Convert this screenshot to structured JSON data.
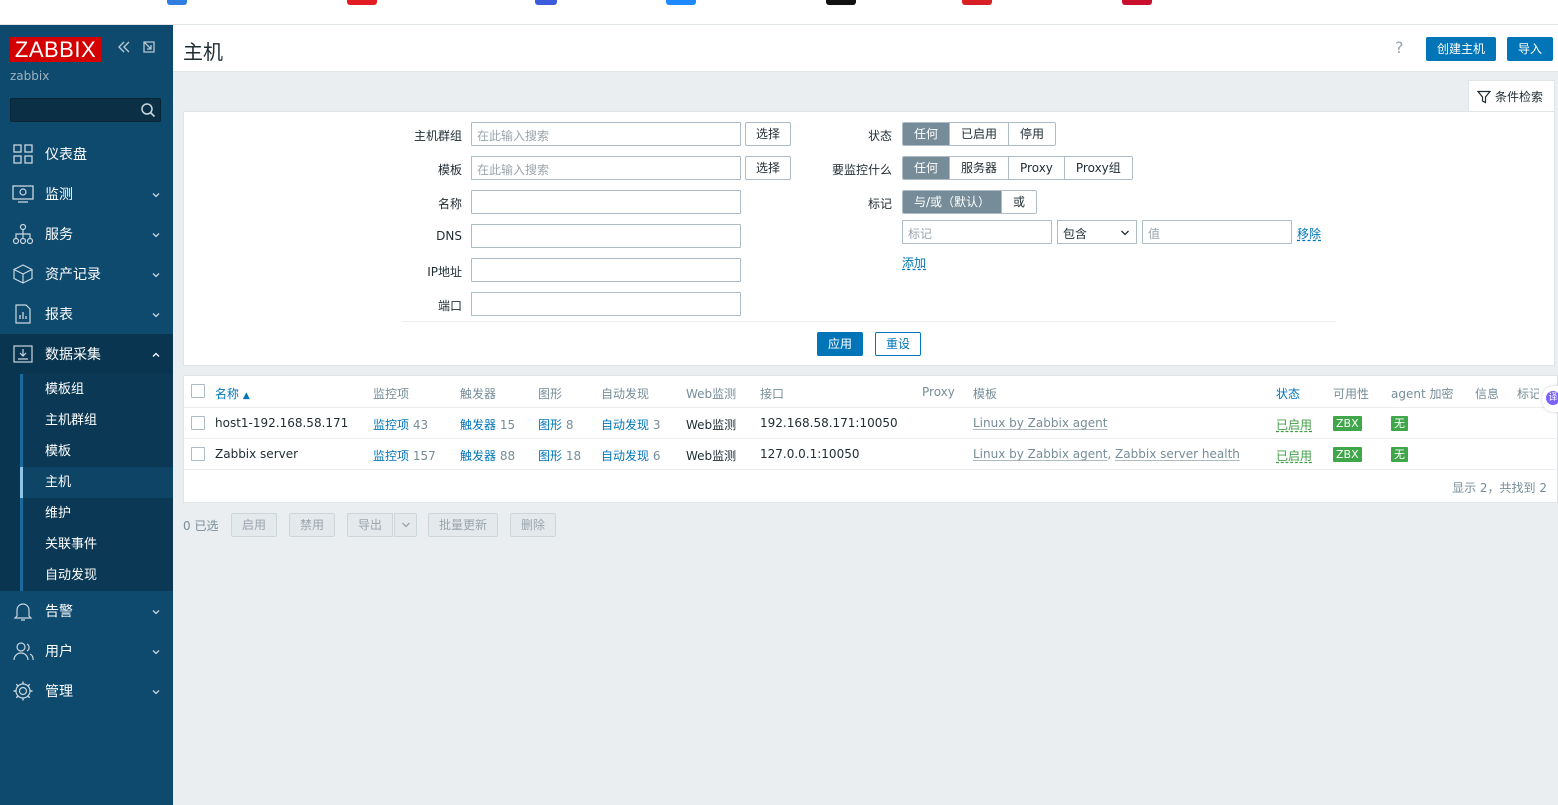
{
  "colors": {
    "sidebar": "#0e4a6e",
    "primary": "#0275b8",
    "logo": "#d40000",
    "green": "#3fa64a"
  },
  "sidebar": {
    "logo": "ZABBIX",
    "user": "zabbix",
    "menu": [
      {
        "label": "仪表盘",
        "icon": "dashboard-icon"
      },
      {
        "label": "监测",
        "icon": "monitoring-icon"
      },
      {
        "label": "服务",
        "icon": "services-icon"
      },
      {
        "label": "资产记录",
        "icon": "inventory-icon"
      },
      {
        "label": "报表",
        "icon": "reports-icon"
      },
      {
        "label": "数据采集",
        "icon": "data-collection-icon"
      }
    ],
    "submenu": [
      "模板组",
      "主机群组",
      "模板",
      "主机",
      "维护",
      "关联事件",
      "自动发现"
    ],
    "menu_bottom": [
      {
        "label": "告警",
        "icon": "alerts-icon"
      },
      {
        "label": "用户",
        "icon": "users-icon"
      },
      {
        "label": "管理",
        "icon": "administration-icon"
      }
    ]
  },
  "header": {
    "title": "主机",
    "help": "?",
    "create_host": "创建主机",
    "import": "导入"
  },
  "filter": {
    "tab_label": "条件检索",
    "host_groups_label": "主机群组",
    "templates_label": "模板",
    "name_label": "名称",
    "dns_label": "DNS",
    "ip_label": "IP地址",
    "port_label": "端口",
    "search_placeholder": "在此输入搜索",
    "select_button": "选择",
    "status_label": "状态",
    "status_options": [
      "任何",
      "已启用",
      "停用"
    ],
    "monitored_by_label": "要监控什么",
    "monitored_by_options": [
      "任何",
      "服务器",
      "Proxy",
      "Proxy组"
    ],
    "tags_label": "标记",
    "tags_options": [
      "与/或（默认）",
      "或"
    ],
    "tag_placeholder": "标记",
    "tag_operator": "包含",
    "value_placeholder": "值",
    "remove": "移除",
    "add": "添加",
    "apply": "应用",
    "reset": "重设"
  },
  "table": {
    "headers": {
      "name": "名称",
      "items": "监控项",
      "triggers": "触发器",
      "graphs": "图形",
      "discovery": "自动发现",
      "web": "Web监测",
      "interface": "接口",
      "proxy": "Proxy",
      "templates": "模板",
      "status": "状态",
      "availability": "可用性",
      "encryption": "agent 加密",
      "info": "信息",
      "tags": "标记"
    },
    "rows": [
      {
        "name": "host1-192.168.58.171",
        "items_label": "监控项",
        "items_count": "43",
        "triggers_label": "触发器",
        "triggers_count": "15",
        "graphs_label": "图形",
        "graphs_count": "8",
        "discovery_label": "自动发现",
        "discovery_count": "3",
        "web": "Web监测",
        "interface": "192.168.58.171:10050",
        "template1": "Linux by Zabbix agent",
        "template2": "",
        "status": "已启用",
        "availability": "ZBX",
        "encryption": "无"
      },
      {
        "name": "Zabbix server",
        "items_label": "监控项",
        "items_count": "157",
        "triggers_label": "触发器",
        "triggers_count": "88",
        "graphs_label": "图形",
        "graphs_count": "18",
        "discovery_label": "自动发现",
        "discovery_count": "6",
        "web": "Web监测",
        "interface": "127.0.0.1:10050",
        "template1": "Linux by Zabbix agent",
        "template2": "Zabbix server health",
        "status": "已启用",
        "availability": "ZBX",
        "encryption": "无"
      }
    ],
    "footer": "显示 2，共找到 2"
  },
  "actions": {
    "selected": "0 已选",
    "enable": "启用",
    "disable": "禁用",
    "export": "导出",
    "mass_update": "批量更新",
    "delete": "删除"
  },
  "translate_widget": "译"
}
